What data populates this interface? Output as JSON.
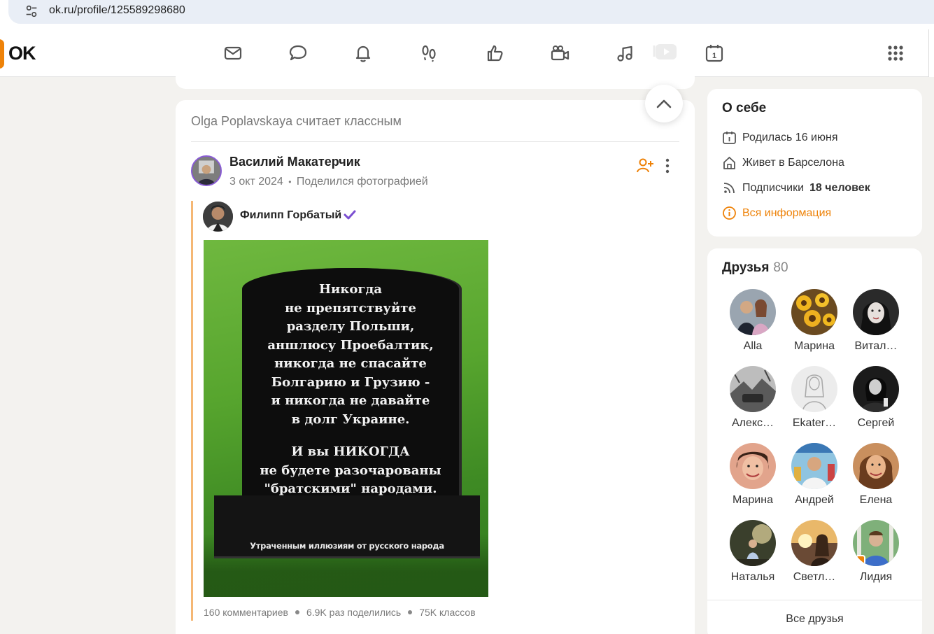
{
  "browser": {
    "url": "ok.ru/profile/125589298680",
    "site_info_icon": "tune-icon"
  },
  "topnav": {
    "logo_text": "OK",
    "icons": [
      "mail-icon",
      "chat-icon",
      "bell-icon",
      "footprints-icon",
      "like-icon",
      "video-camera-icon",
      "music-icon",
      "video-play-icon",
      "calendar-icon",
      "apps-grid-icon"
    ],
    "calendar_day": "1"
  },
  "feed": {
    "header": "Olga Poplavskaya считает классным",
    "author": {
      "name": "Василий Макатерчик",
      "date": "3 окт 2024",
      "separator": "•",
      "action": "Поделился фотографией"
    },
    "repost": {
      "name": "Филипп Горбатый"
    },
    "photo": {
      "stone_lines": [
        "Никогда",
        "не препятствуйте",
        "разделу Польши,",
        "аншлюсу Проебалтик,",
        "никогда не спасайте",
        "Болгарию и Грузию -",
        "и никогда не давайте",
        "в долг Украине.",
        "",
        "И вы НИКОГДА",
        "не будете разочарованы",
        "\"братскими\" народами."
      ],
      "base_text": "Утраченным иллюзиям от русского народа"
    },
    "stats": {
      "comments": "160 комментариев",
      "shares": "6.9K раз поделились",
      "likes": "75K классов"
    }
  },
  "about": {
    "title": "О себе",
    "born": "Родилась 16 июня",
    "lives": "Живет в Барселона",
    "followers_label": "Подписчики",
    "followers_value": "18 человек",
    "all_info": "Вся информация"
  },
  "friends": {
    "title": "Друзья",
    "count": "80",
    "items": [
      {
        "name": "Alla"
      },
      {
        "name": "Марина"
      },
      {
        "name": "Витал…"
      },
      {
        "name": "Алекс…"
      },
      {
        "name": "Ekater…"
      },
      {
        "name": "Сергей"
      },
      {
        "name": "Марина"
      },
      {
        "name": "Андрей"
      },
      {
        "name": "Елена"
      },
      {
        "name": "Наталья"
      },
      {
        "name": "Светл…"
      },
      {
        "name": "Лидия"
      }
    ],
    "all_label": "Все друзья"
  },
  "colors": {
    "brand_orange": "#ee8208",
    "verified_purple": "#7b4fd1",
    "background": "#f3f2ef"
  }
}
